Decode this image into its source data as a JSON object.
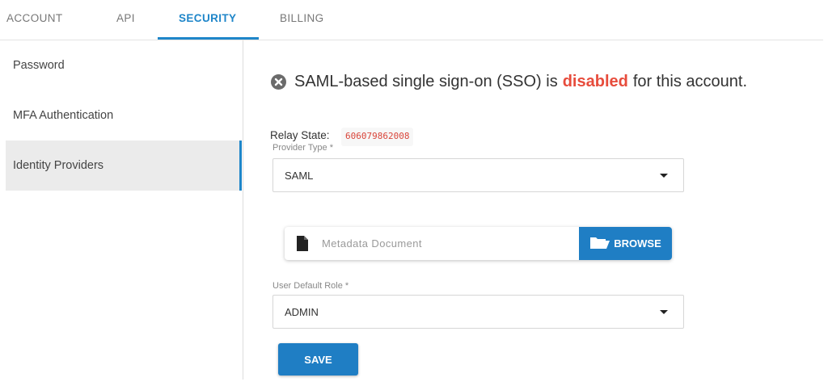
{
  "tabs": [
    {
      "label": "ACCOUNT"
    },
    {
      "label": "API"
    },
    {
      "label": "SECURITY"
    },
    {
      "label": "BILLING"
    }
  ],
  "active_tab": "SECURITY",
  "sidebar": {
    "items": [
      {
        "label": "Password"
      },
      {
        "label": "MFA Authentication"
      },
      {
        "label": "Identity Providers"
      }
    ],
    "active_item": "Identity Providers"
  },
  "main": {
    "status": {
      "prefix": "SAML-based single sign-on (SSO) is",
      "state_word": "disabled",
      "suffix": "for this account.",
      "icon": "x-circle-icon"
    },
    "relay": {
      "label": "Relay State:",
      "value": "606079862008"
    },
    "provider_type": {
      "label": "Provider Type *",
      "value": "SAML"
    },
    "metadata": {
      "placeholder": "Metadata Document",
      "browse_label": "BROWSE"
    },
    "user_role": {
      "label": "User Default Role *",
      "value": "ADMIN"
    },
    "save_label": "SAVE"
  },
  "colors": {
    "accent": "#1f86c9",
    "disabled_red": "#e74c3c",
    "code_red": "#d9453a"
  }
}
